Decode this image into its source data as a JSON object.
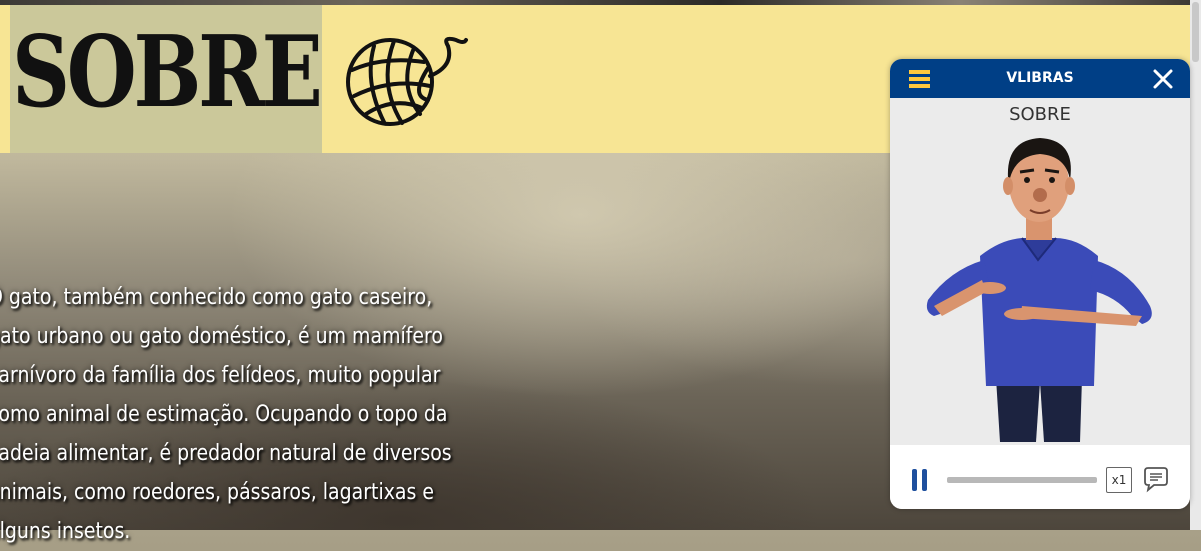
{
  "header": {
    "title": "SOBRE",
    "icon": "yarn-ball-icon",
    "band_color": "#f7e594"
  },
  "article": {
    "lines": [
      "O gato, também conhecido como gato caseiro,",
      "gato urbano ou gato doméstico, é um mamífero",
      "carnívoro da família dos felídeos, muito popular",
      "como animal de estimação. Ocupando o topo da",
      "cadeia alimentar, é predador natural de diversos",
      "animais, como roedores, pássaros, lagartixas e",
      "alguns insetos."
    ]
  },
  "vlibras": {
    "title": "VLIBRAS",
    "caption": "SOBRE",
    "speed": "x1",
    "header_color": "#003f86",
    "accent_color": "#ffc83d",
    "icons": [
      "menu-icon",
      "close-icon",
      "pause-icon",
      "subtitles-icon"
    ]
  }
}
